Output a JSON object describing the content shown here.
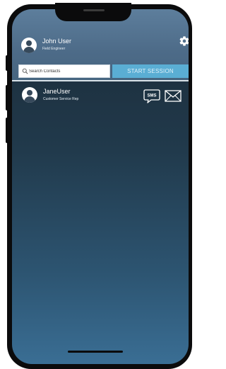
{
  "user": {
    "name": "John User",
    "role": "Field Engineer"
  },
  "search": {
    "placeholder": "Search Contacts",
    "value": ""
  },
  "actions": {
    "start_session_label": "START SESSION"
  },
  "contacts": [
    {
      "name": "JaneUser",
      "role": "Customer Service Rep",
      "sms_label": "SMS"
    }
  ],
  "colors": {
    "header_bg": "#4d6b88",
    "content_bg_top": "#1b2a37",
    "content_bg_bottom": "#3a6e94",
    "accent_button": "#5aaed4",
    "phone_frame": "#0b0b0c"
  },
  "icons": {
    "settings": "gear-icon",
    "search": "search-icon",
    "sms": "sms-bubble-icon",
    "email": "envelope-icon",
    "avatar": "user-avatar-icon"
  }
}
